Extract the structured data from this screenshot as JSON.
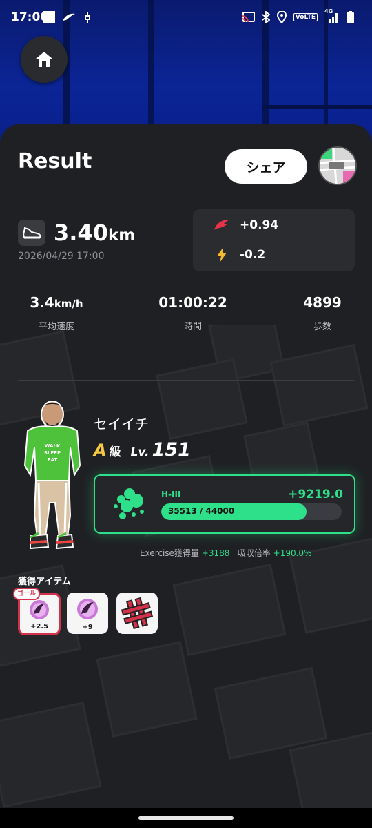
{
  "status": {
    "time": "17:00",
    "network_label": "VoLTE",
    "network_type": "4G"
  },
  "header": {
    "title": "Result",
    "share_label": "シェア"
  },
  "summary": {
    "distance_value": "3.40",
    "distance_unit": "km",
    "datetime": "2026/04/29 17:00",
    "gain_primary": "+0.94",
    "gain_energy": "-0.2"
  },
  "stats": [
    {
      "value": "3.4",
      "unit": "km/h",
      "label": "平均速度"
    },
    {
      "value": "01:00:22",
      "unit": "",
      "label": "時間"
    },
    {
      "value": "4899",
      "unit": "",
      "label": "歩数"
    }
  ],
  "character": {
    "name": "セイイチ",
    "rank": "A",
    "rank_suffix": "級",
    "level_prefix": "Lv.",
    "level": "151",
    "shirt_text": "WALK SLEEP EAT"
  },
  "energy": {
    "label": "H-III",
    "gain": "+9219.0",
    "progress_text": "35513 / 44000",
    "current": 35513,
    "max": 44000
  },
  "exercise": {
    "label1": "Exercise獲得量",
    "value1": "+3188",
    "label2": "吸収倍率",
    "value2": "+190.0%"
  },
  "items": {
    "title": "獲得アイテム",
    "goal_badge": "ゴール",
    "list": [
      {
        "count": "+2.5",
        "goal": true
      },
      {
        "count": "+9",
        "goal": false
      },
      {
        "count": "",
        "goal": false
      }
    ]
  },
  "colors": {
    "accent_green": "#2fe08a",
    "goal_red": "#d6314b",
    "rank_gold": "#f5c940",
    "bolt_yellow": "#f5b82e",
    "feather_red": "#e8324a"
  }
}
